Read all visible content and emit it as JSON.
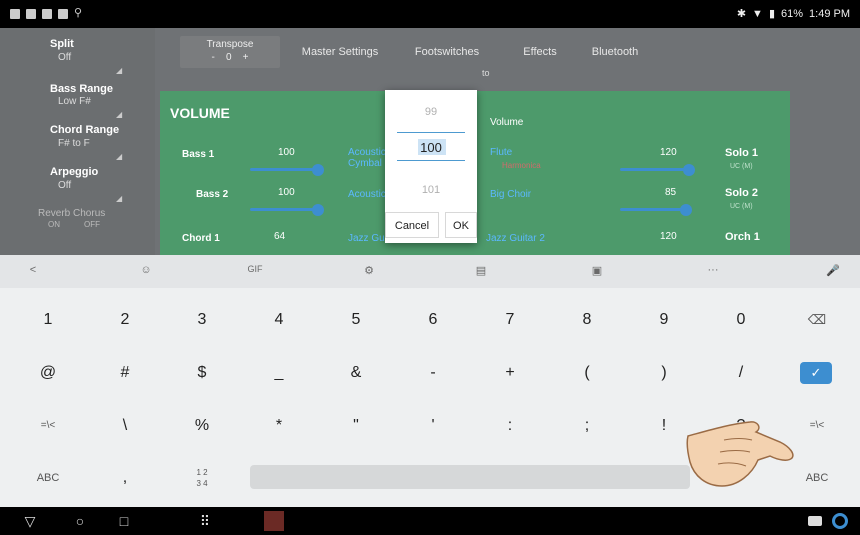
{
  "status_bar": {
    "battery": "61%",
    "time": "1:49 PM"
  },
  "left_panel": {
    "split": {
      "label": "Split",
      "value": "Off"
    },
    "bass_range": {
      "label": "Bass Range",
      "value": "Low F#"
    },
    "chord_range": {
      "label": "Chord Range",
      "value": "F# to F"
    },
    "arpeggio": {
      "label": "Arpeggio",
      "value": "Off"
    },
    "reverb_chorus": {
      "label": "Reverb Chorus",
      "on": "ON",
      "off": "OFF"
    }
  },
  "tabs": {
    "transpose_label": "Transpose",
    "transpose_value": "0",
    "transpose_minus": "-",
    "transpose_plus": "+",
    "master_settings": "Master Settings",
    "footswitches": "Footswitches",
    "effects": "Effects",
    "bluetooth": "Bluetooth",
    "partial": "to"
  },
  "volume_panel": {
    "title": "VOLUME",
    "volume_label": "Volume",
    "rows": [
      {
        "name": "Bass 1",
        "value": "100",
        "instrument": "Acoustic Cymbal"
      },
      {
        "name": "Bass 2",
        "value": "100",
        "instrument": "Acoustic"
      },
      {
        "name": "Chord 1",
        "value": "64",
        "instrument": "Jazz Guitar 1"
      }
    ],
    "right_rows": [
      {
        "instrument": "Flute",
        "sub": "Harmonica",
        "value": "120",
        "solo": "Solo 1",
        "uc": "UC (M)"
      },
      {
        "instrument": "Big Choir",
        "value": "85",
        "solo": "Solo 2",
        "uc": "UC (M)"
      },
      {
        "instrument": "Jazz Guitar 2",
        "value": "120",
        "solo": "Orch 1"
      }
    ]
  },
  "number_picker": {
    "prev": "99",
    "current": "100",
    "next": "101",
    "cancel": "Cancel",
    "ok": "OK"
  },
  "keyboard": {
    "toolbar": [
      "<",
      "☺",
      "GIF",
      "⚙",
      "▤",
      "▣",
      "···",
      "🎤"
    ],
    "row1": [
      "1",
      "2",
      "3",
      "4",
      "5",
      "6",
      "7",
      "8",
      "9",
      "0",
      "⌫"
    ],
    "row2": [
      "@",
      "#",
      "$",
      "_",
      "&",
      "-",
      "+",
      "(",
      ")",
      "/",
      "✓"
    ],
    "row3": [
      "=\\<",
      "\\",
      "%",
      "*",
      "\"",
      "'",
      ":",
      ";",
      "!",
      "?",
      "=\\<"
    ],
    "row4_left": [
      "ABC",
      ",",
      "1 2\n3 4"
    ],
    "row4_right": "ABC"
  },
  "nav_bar": {
    "back": "▽",
    "home": "○",
    "recents": "□",
    "apps": "⠿"
  }
}
